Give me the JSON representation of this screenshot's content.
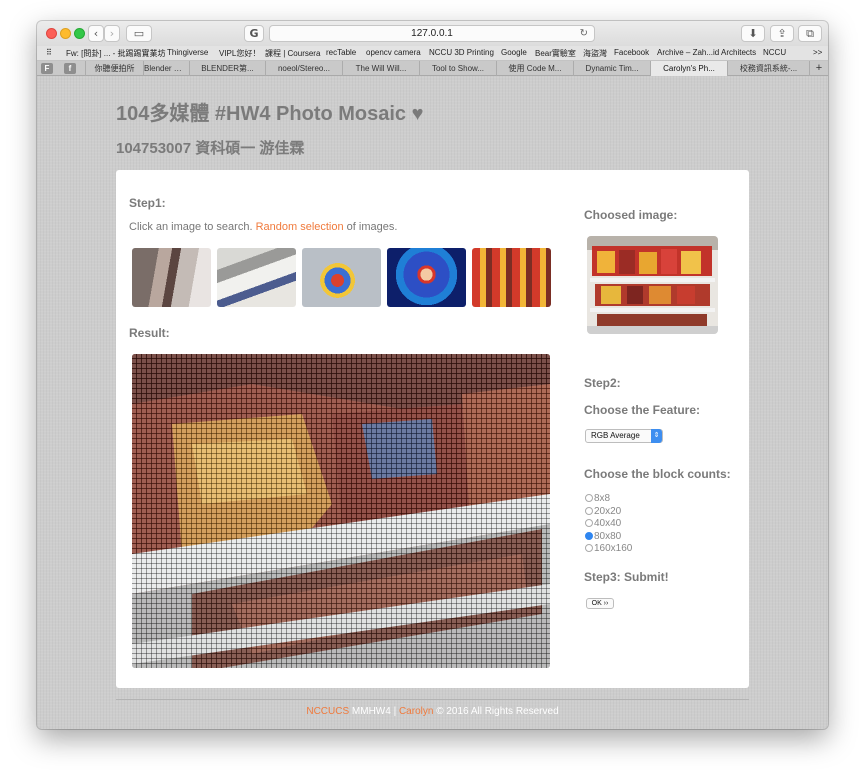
{
  "browser": {
    "url": "127.0.0.1",
    "bookmarks": [
      "Fw: [問卦] ... - 批踢踢實業坊",
      "Thingiverse",
      "VIPL您好！",
      "課程 | Coursera",
      "recTable",
      "opencv camera",
      "NCCU 3D Printing",
      "Google",
      "Bear實驗室",
      "海盜灣",
      "Facebook",
      "Archive – Zah...id Architects",
      "NCCU"
    ],
    "bookmarks_more": ">>",
    "tab_icons": [
      "F",
      "f"
    ],
    "tabs": [
      "你聽便拍所",
      "Blender 之 S",
      "BLENDER第...",
      "noeol/Stereo...",
      "The Will Will...",
      "Tool to Show...",
      "使用 Code M...",
      "Dynamic Tim...",
      "Carolyn's Ph...",
      "校務資訊系統-..."
    ],
    "active_tab": 8,
    "new_tab": "+"
  },
  "page": {
    "title": "104多媒體 #HW4 Photo Mosaic ♥",
    "subtitle": "104753007 資科碩一 游佳霖",
    "step1": "Step1:",
    "instruction_before": "Click an image to search. ",
    "instruction_link": "Random selection",
    "instruction_after": " of images.",
    "result_label": "Result:",
    "chosen_label": "Choosed image:",
    "step2": "Step2:",
    "feature_label": "Choose the Feature:",
    "feature_value": "RGB Average",
    "blocks_label": "Choose the block counts:",
    "block_options": [
      "8x8",
      "20x20",
      "40x40",
      "80x80",
      "160x160"
    ],
    "block_selected": 3,
    "step3": "Step3: Submit!",
    "ok_label": "OK ››"
  },
  "footer": {
    "org": "NCCUCS",
    "course": " MMHW4 | ",
    "author": "Carolyn",
    "rest": " © 2016 All Rights Reserved"
  },
  "colors": {
    "accent": "#f07a3c",
    "selected_radio": "#2f86f0"
  }
}
